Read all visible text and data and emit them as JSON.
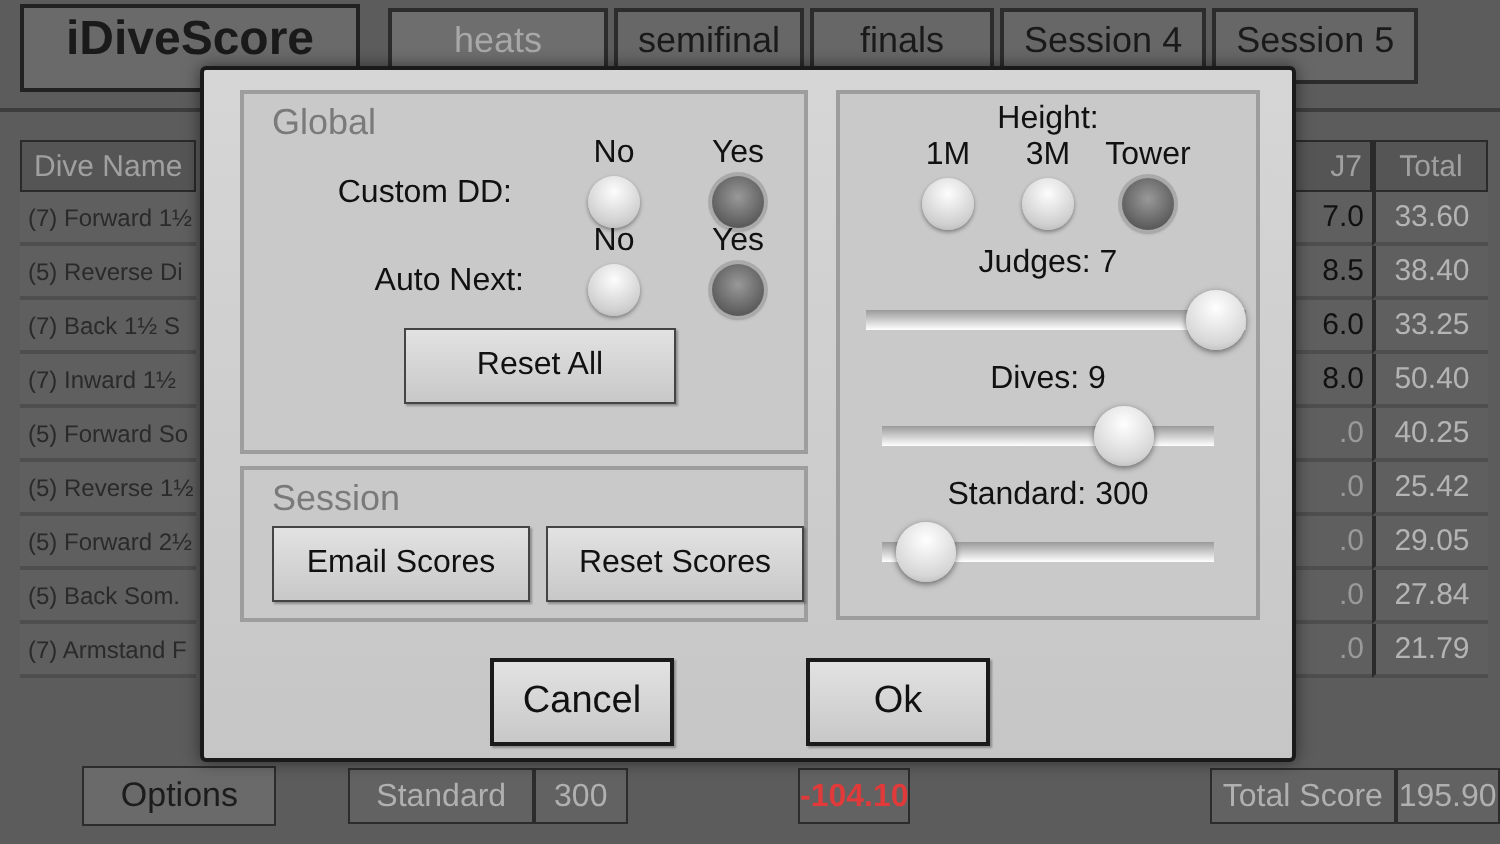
{
  "app": {
    "logo": "iDiveScore"
  },
  "tabs": [
    {
      "label": "heats",
      "selected": true
    },
    {
      "label": "semifinal",
      "selected": false
    },
    {
      "label": "finals",
      "selected": false
    },
    {
      "label": "Session 4",
      "selected": false
    },
    {
      "label": "Session 5",
      "selected": false
    }
  ],
  "table": {
    "columns": [
      "Dive Name",
      "J7",
      "Total"
    ],
    "rows": [
      {
        "dive_name": "(7) Forward 1½",
        "j7": "7.0",
        "total": "33.60",
        "entered": true
      },
      {
        "dive_name": "(5) Reverse Di",
        "j7": "8.5",
        "total": "38.40",
        "entered": true
      },
      {
        "dive_name": "(7) Back 1½ S",
        "j7": "6.0",
        "total": "33.25",
        "entered": true
      },
      {
        "dive_name": "(7) Inward 1½",
        "j7": "8.0",
        "total": "50.40",
        "entered": true
      },
      {
        "dive_name": "(5) Forward So",
        "j7": ".0",
        "total": "40.25",
        "entered": false
      },
      {
        "dive_name": "(5) Reverse 1½",
        "j7": ".0",
        "total": "25.42",
        "entered": false
      },
      {
        "dive_name": "(5) Forward 2½",
        "j7": ".0",
        "total": "29.05",
        "entered": false
      },
      {
        "dive_name": "(5) Back Som.",
        "j7": ".0",
        "total": "27.84",
        "entered": false
      },
      {
        "dive_name": "(7) Armstand F",
        "j7": ".0",
        "total": "21.79",
        "entered": false
      }
    ]
  },
  "footer": {
    "options_button": "Options",
    "standard_label": "Standard",
    "standard_value": "300",
    "difference": "-104.10",
    "total_label": "Total Score",
    "total_value": "195.90"
  },
  "dialog": {
    "global": {
      "title": "Global",
      "options": [
        {
          "label": "Custom DD:",
          "choices": [
            {
              "label": "No",
              "selected": false
            },
            {
              "label": "Yes",
              "selected": true
            }
          ]
        },
        {
          "label": "Auto Next:",
          "choices": [
            {
              "label": "No",
              "selected": false
            },
            {
              "label": "Yes",
              "selected": true
            }
          ]
        }
      ],
      "reset_button": "Reset All"
    },
    "session": {
      "title": "Session",
      "buttons": [
        "Email Scores",
        "Reset Scores"
      ]
    },
    "height": {
      "label": "Height:",
      "choices": [
        {
          "label": "1M",
          "selected": false
        },
        {
          "label": "3M",
          "selected": false
        },
        {
          "label": "Tower",
          "selected": true
        }
      ]
    },
    "sliders": [
      {
        "label": "Judges: 7",
        "level": 1.0
      },
      {
        "label": "Dives: 9",
        "level": 0.78
      },
      {
        "label": "Standard: 300",
        "level": 0.05
      }
    ],
    "buttons": [
      "Cancel",
      "Ok"
    ]
  }
}
